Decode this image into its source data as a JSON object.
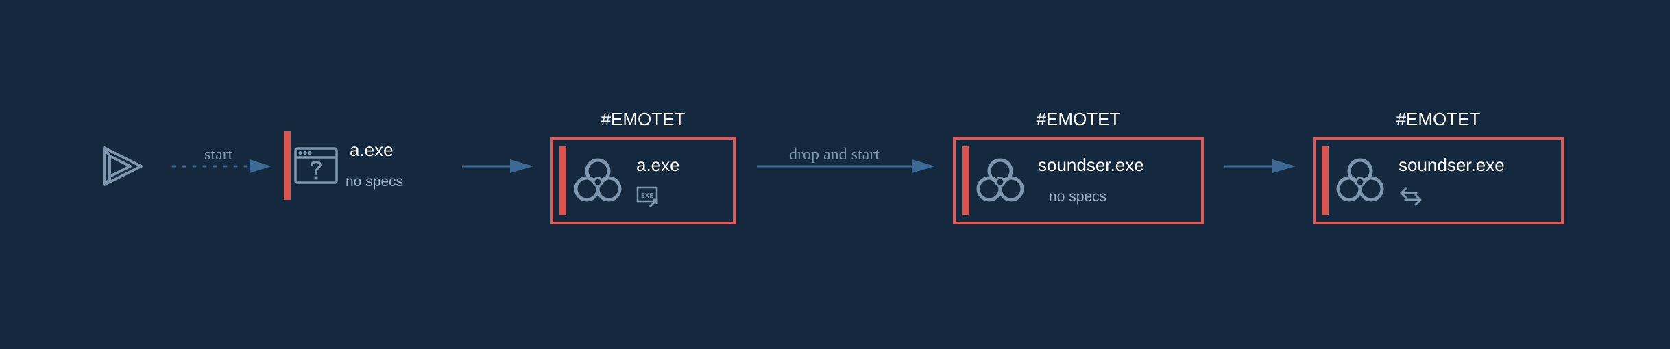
{
  "diagram": {
    "start_edge_label": "start",
    "drop_edge_label": "drop and start",
    "nodes": [
      {
        "name": "a.exe",
        "subtitle": "no specs"
      },
      {
        "tag": "#EMOTET",
        "name": "a.exe"
      },
      {
        "tag": "#EMOTET",
        "name": "soundser.exe",
        "subtitle": "no specs"
      },
      {
        "tag": "#EMOTET",
        "name": "soundser.exe"
      }
    ],
    "icons": {
      "start": "play-icon",
      "unknown_process": "window-question-icon",
      "malware": "biohazard-icon",
      "executable": "exe-file-icon",
      "network": "exchange-arrows-icon"
    },
    "colors": {
      "background": "#14293d",
      "malicious_border": "#e05a5a",
      "edge": "#3d6a94",
      "icon": "#7f97ae"
    }
  }
}
